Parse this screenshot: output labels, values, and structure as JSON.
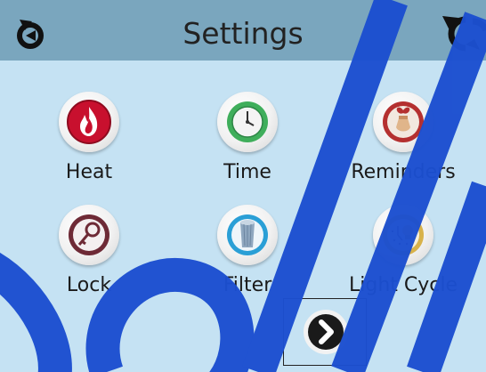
{
  "header": {
    "title": "Settings",
    "back_icon": "back-icon",
    "refresh_icon": "refresh-icon"
  },
  "tiles": [
    {
      "label": "Heat",
      "icon": "flame-icon"
    },
    {
      "label": "Time",
      "icon": "clock-icon"
    },
    {
      "label": "Reminders",
      "icon": "reminder-icon"
    },
    {
      "label": "Lock",
      "icon": "key-icon"
    },
    {
      "label": "Filter",
      "icon": "filter-icon"
    },
    {
      "label": "Light Cycle",
      "icon": "light-cycle-icon"
    }
  ],
  "next_icon": "chevron-right-icon",
  "colors": {
    "header_bg": "#7aa6be",
    "body_bg": "#c5e2f3",
    "heat_red": "#c8102e",
    "time_green": "#3fae5b",
    "reminder_red": "#b43030",
    "lock_maroon": "#6e2a36",
    "filter_blue": "#2a9fd6",
    "light_gold": "#d8b24a",
    "watermark_blue": "#1c4fd0"
  }
}
